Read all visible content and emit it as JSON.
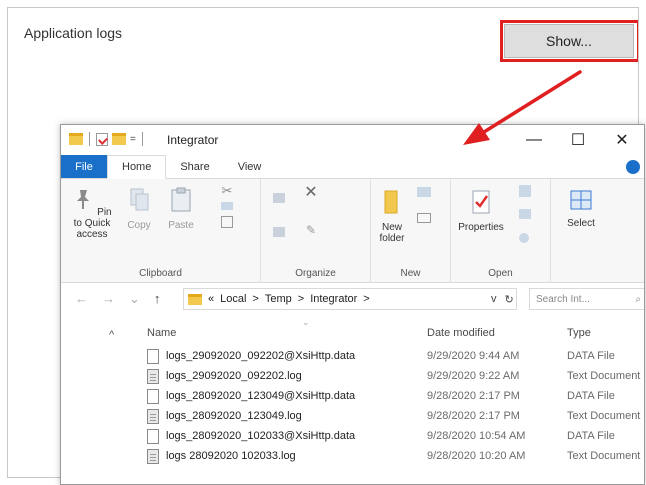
{
  "settings": {
    "label": "Application logs",
    "show_button": "Show..."
  },
  "colors": {
    "highlight": "#e02020",
    "file_tab": "#1a6fc8",
    "folder": "#f2c94c"
  },
  "explorer": {
    "title": "Integrator",
    "quick_access_dropdown": "=",
    "window_buttons": {
      "minimize": "—",
      "maximize": "☐",
      "close": "✕"
    },
    "tabs": {
      "file": "File",
      "home": "Home",
      "share": "Share",
      "view": "View"
    },
    "ribbon": {
      "clipboard": {
        "label": "Clipboard",
        "pin": "Pin to Quick access",
        "copy": "Copy",
        "paste": "Paste"
      },
      "organize": {
        "label": "Organize"
      },
      "new": {
        "label": "New",
        "new_folder": "New folder"
      },
      "open": {
        "label": "Open",
        "properties": "Properties"
      },
      "select": {
        "select": "Select"
      }
    },
    "address": {
      "prefix": "«",
      "parts": [
        "Local",
        "Temp",
        "Integrator"
      ],
      "separator": ">",
      "search_placeholder": "Search Int...",
      "dropdown_glyph": "v",
      "refresh_glyph": "↻",
      "search_icon": "⌕"
    },
    "columns": {
      "name": "Name",
      "date": "Date modified",
      "type": "Type"
    },
    "files": [
      {
        "name": "logs_29092020_092202@XsiHttp.data",
        "date": "9/29/2020 9:44 AM",
        "type": "DATA File",
        "icon": "data-file-icon"
      },
      {
        "name": "logs_29092020_092202.log",
        "date": "9/29/2020 9:22 AM",
        "type": "Text Document",
        "icon": "text-file-icon"
      },
      {
        "name": "logs_28092020_123049@XsiHttp.data",
        "date": "9/28/2020 2:17 PM",
        "type": "DATA File",
        "icon": "data-file-icon"
      },
      {
        "name": "logs_28092020_123049.log",
        "date": "9/28/2020 2:17 PM",
        "type": "Text Document",
        "icon": "text-file-icon"
      },
      {
        "name": "logs_28092020_102033@XsiHttp.data",
        "date": "9/28/2020 10:54 AM",
        "type": "DATA File",
        "icon": "data-file-icon"
      },
      {
        "name": "logs 28092020 102033.log",
        "date": "9/28/2020 10:20 AM",
        "type": "Text Document",
        "icon": "text-file-icon"
      }
    ]
  }
}
